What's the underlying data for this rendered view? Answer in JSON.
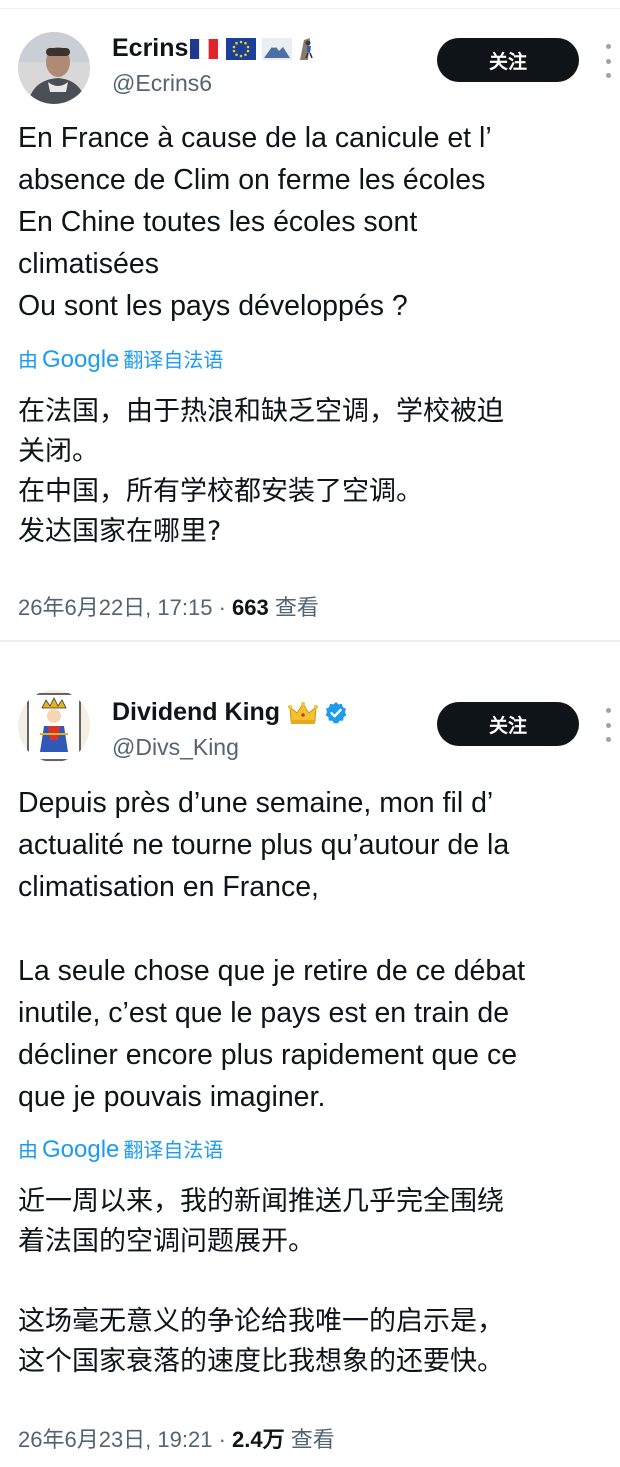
{
  "tweets": [
    {
      "display_name": "Ecrins",
      "handle": "@Ecrins6",
      "name_emojis": [
        "france-flag-icon",
        "eu-flag-icon",
        "mountain-icon",
        "climber-icon"
      ],
      "verified": false,
      "follow_label": "关注",
      "text": "En France à cause de la canicule et l’\nabsence de Clim on ferme les écoles\nEn Chine toutes les écoles sont\nclimatisées\nOu sont les pays développés ?",
      "translated_prefix": "由",
      "translated_brand": "Google",
      "translated_suffix": "翻译自法语",
      "translated_text": "在法国，由于热浪和缺乏空调，学校被迫\n关闭。\n在中国，所有学校都安装了空调。\n发达国家在哪里?",
      "date": "26年6月22日, 17:15 · ",
      "views": "663",
      "views_label": " 查看"
    },
    {
      "display_name": "Dividend King",
      "handle": "@Divs_King",
      "name_emojis": [
        "crown-icon"
      ],
      "verified": true,
      "follow_label": "关注",
      "text": "Depuis près d’une semaine, mon fil d’\nactualité ne tourne plus qu’autour de la\nclimatisation en France,\n\nLa seule chose que je retire de ce débat\ninutile, c’est que le pays est en train de\ndécliner encore plus rapidement que ce\nque je pouvais imaginer.",
      "translated_prefix": "由",
      "translated_brand": "Google",
      "translated_suffix": "翻译自法语",
      "translated_text": "近一周以来，我的新闻推送几乎完全围绕\n着法国的空调问题展开。\n\n这场毫无意义的争论给我唯一的启示是，\n这个国家衰落的速度比我想象的还要快。",
      "date": "26年6月23日, 19:21 · ",
      "views": "2.4万",
      "views_label": " 查看"
    }
  ],
  "colors": {
    "link_blue": "#1d9bf0",
    "follow_button_bg": "#0f1419",
    "muted_text": "#536471",
    "verified_blue": "#1d9bf0",
    "crown_gold": "#f2c230"
  }
}
